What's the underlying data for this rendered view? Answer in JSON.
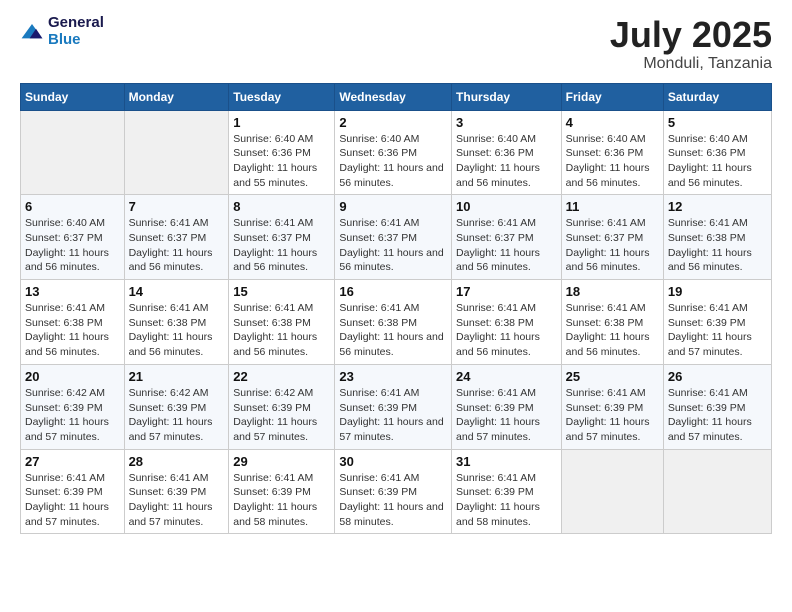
{
  "logo": {
    "text_general": "General",
    "text_blue": "Blue"
  },
  "title": "July 2025",
  "subtitle": "Monduli, Tanzania",
  "days_header": [
    "Sunday",
    "Monday",
    "Tuesday",
    "Wednesday",
    "Thursday",
    "Friday",
    "Saturday"
  ],
  "weeks": [
    [
      {
        "day": "",
        "empty": true
      },
      {
        "day": "",
        "empty": true
      },
      {
        "day": "1",
        "sunrise": "6:40 AM",
        "sunset": "6:36 PM",
        "daylight": "11 hours and 55 minutes."
      },
      {
        "day": "2",
        "sunrise": "6:40 AM",
        "sunset": "6:36 PM",
        "daylight": "11 hours and 56 minutes."
      },
      {
        "day": "3",
        "sunrise": "6:40 AM",
        "sunset": "6:36 PM",
        "daylight": "11 hours and 56 minutes."
      },
      {
        "day": "4",
        "sunrise": "6:40 AM",
        "sunset": "6:36 PM",
        "daylight": "11 hours and 56 minutes."
      },
      {
        "day": "5",
        "sunrise": "6:40 AM",
        "sunset": "6:36 PM",
        "daylight": "11 hours and 56 minutes."
      }
    ],
    [
      {
        "day": "6",
        "sunrise": "6:40 AM",
        "sunset": "6:37 PM",
        "daylight": "11 hours and 56 minutes."
      },
      {
        "day": "7",
        "sunrise": "6:41 AM",
        "sunset": "6:37 PM",
        "daylight": "11 hours and 56 minutes."
      },
      {
        "day": "8",
        "sunrise": "6:41 AM",
        "sunset": "6:37 PM",
        "daylight": "11 hours and 56 minutes."
      },
      {
        "day": "9",
        "sunrise": "6:41 AM",
        "sunset": "6:37 PM",
        "daylight": "11 hours and 56 minutes."
      },
      {
        "day": "10",
        "sunrise": "6:41 AM",
        "sunset": "6:37 PM",
        "daylight": "11 hours and 56 minutes."
      },
      {
        "day": "11",
        "sunrise": "6:41 AM",
        "sunset": "6:37 PM",
        "daylight": "11 hours and 56 minutes."
      },
      {
        "day": "12",
        "sunrise": "6:41 AM",
        "sunset": "6:38 PM",
        "daylight": "11 hours and 56 minutes."
      }
    ],
    [
      {
        "day": "13",
        "sunrise": "6:41 AM",
        "sunset": "6:38 PM",
        "daylight": "11 hours and 56 minutes."
      },
      {
        "day": "14",
        "sunrise": "6:41 AM",
        "sunset": "6:38 PM",
        "daylight": "11 hours and 56 minutes."
      },
      {
        "day": "15",
        "sunrise": "6:41 AM",
        "sunset": "6:38 PM",
        "daylight": "11 hours and 56 minutes."
      },
      {
        "day": "16",
        "sunrise": "6:41 AM",
        "sunset": "6:38 PM",
        "daylight": "11 hours and 56 minutes."
      },
      {
        "day": "17",
        "sunrise": "6:41 AM",
        "sunset": "6:38 PM",
        "daylight": "11 hours and 56 minutes."
      },
      {
        "day": "18",
        "sunrise": "6:41 AM",
        "sunset": "6:38 PM",
        "daylight": "11 hours and 56 minutes."
      },
      {
        "day": "19",
        "sunrise": "6:41 AM",
        "sunset": "6:39 PM",
        "daylight": "11 hours and 57 minutes."
      }
    ],
    [
      {
        "day": "20",
        "sunrise": "6:42 AM",
        "sunset": "6:39 PM",
        "daylight": "11 hours and 57 minutes."
      },
      {
        "day": "21",
        "sunrise": "6:42 AM",
        "sunset": "6:39 PM",
        "daylight": "11 hours and 57 minutes."
      },
      {
        "day": "22",
        "sunrise": "6:42 AM",
        "sunset": "6:39 PM",
        "daylight": "11 hours and 57 minutes."
      },
      {
        "day": "23",
        "sunrise": "6:41 AM",
        "sunset": "6:39 PM",
        "daylight": "11 hours and 57 minutes."
      },
      {
        "day": "24",
        "sunrise": "6:41 AM",
        "sunset": "6:39 PM",
        "daylight": "11 hours and 57 minutes."
      },
      {
        "day": "25",
        "sunrise": "6:41 AM",
        "sunset": "6:39 PM",
        "daylight": "11 hours and 57 minutes."
      },
      {
        "day": "26",
        "sunrise": "6:41 AM",
        "sunset": "6:39 PM",
        "daylight": "11 hours and 57 minutes."
      }
    ],
    [
      {
        "day": "27",
        "sunrise": "6:41 AM",
        "sunset": "6:39 PM",
        "daylight": "11 hours and 57 minutes."
      },
      {
        "day": "28",
        "sunrise": "6:41 AM",
        "sunset": "6:39 PM",
        "daylight": "11 hours and 57 minutes."
      },
      {
        "day": "29",
        "sunrise": "6:41 AM",
        "sunset": "6:39 PM",
        "daylight": "11 hours and 58 minutes."
      },
      {
        "day": "30",
        "sunrise": "6:41 AM",
        "sunset": "6:39 PM",
        "daylight": "11 hours and 58 minutes."
      },
      {
        "day": "31",
        "sunrise": "6:41 AM",
        "sunset": "6:39 PM",
        "daylight": "11 hours and 58 minutes."
      },
      {
        "day": "",
        "empty": true
      },
      {
        "day": "",
        "empty": true
      }
    ]
  ],
  "labels": {
    "sunrise": "Sunrise:",
    "sunset": "Sunset:",
    "daylight": "Daylight:"
  }
}
